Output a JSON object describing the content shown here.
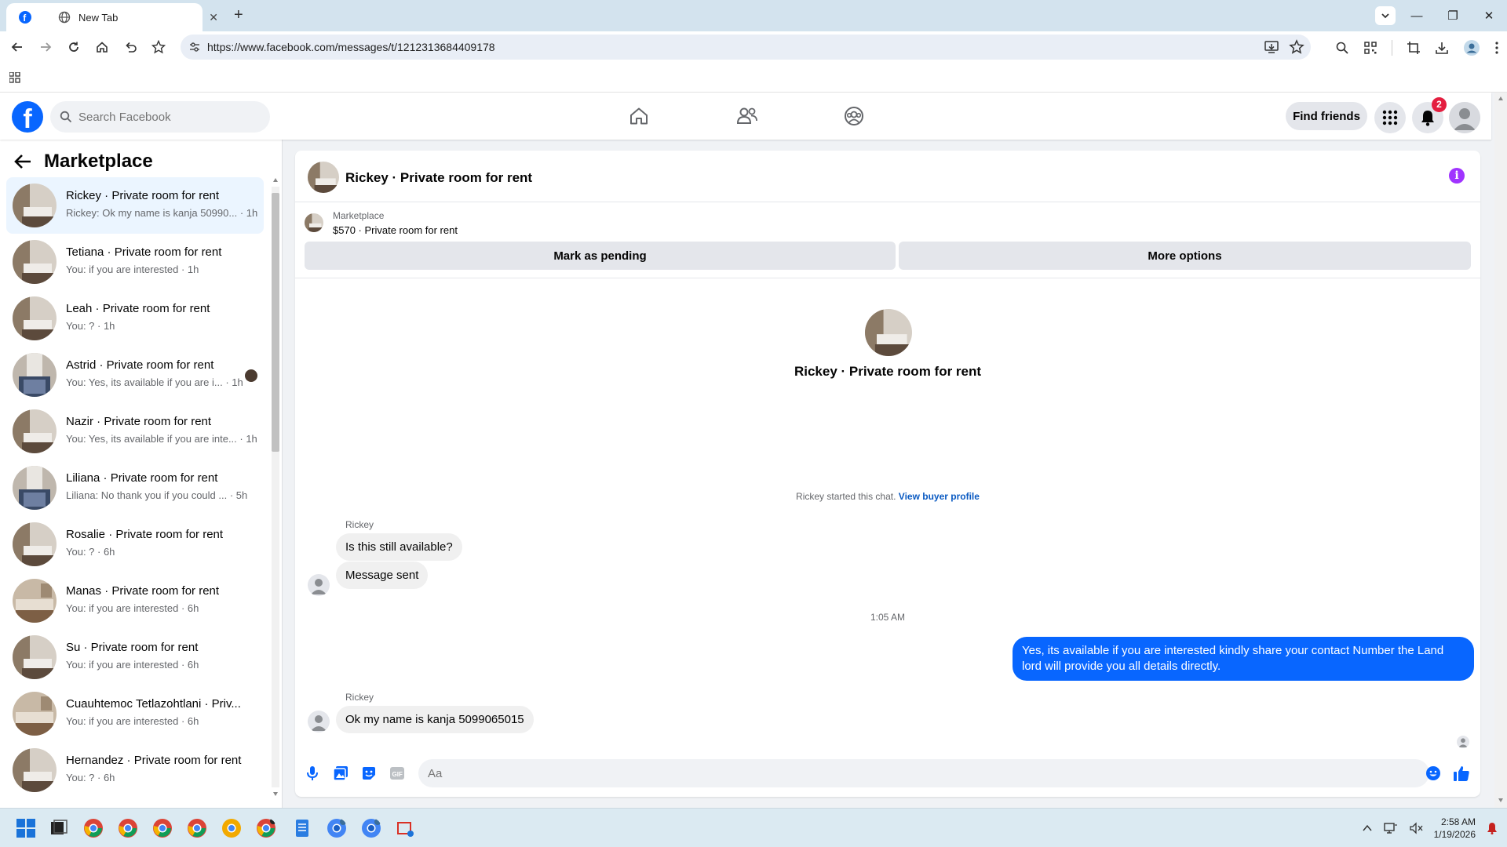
{
  "browser": {
    "tabs": [
      {
        "label": "",
        "active": true
      },
      {
        "label": "New Tab",
        "active": false
      }
    ],
    "url": "https://www.facebook.com/messages/t/1212313684409178"
  },
  "fb_header": {
    "search_placeholder": "Search Facebook",
    "find_friends_label": "Find friends",
    "notification_count": "2"
  },
  "sidebar": {
    "title": "Marketplace",
    "conversations": [
      {
        "name": "Rickey · Private room for rent",
        "preview": "Rickey: Ok my name is kanja 50990... · 1h",
        "selected": true
      },
      {
        "name": "Tetiana · Private room for rent",
        "preview": "You: if you are interested · 1h"
      },
      {
        "name": "Leah · Private room for rent",
        "preview": "You: ? · 1h"
      },
      {
        "name": "Astrid · Private room for rent",
        "preview": "You: Yes, its available if you are i... · 1h"
      },
      {
        "name": "Nazir · Private room for rent",
        "preview": "You: Yes, its available if you are inte... · 1h"
      },
      {
        "name": "Liliana · Private room for rent",
        "preview": "Liliana: No thank you if you could ... · 5h"
      },
      {
        "name": "Rosalie · Private room for rent",
        "preview": "You: ? · 6h"
      },
      {
        "name": "Manas · Private room for rent",
        "preview": "You: if you are interested · 6h"
      },
      {
        "name": "Su · Private room for rent",
        "preview": "You: if you are interested · 6h"
      },
      {
        "name": "Cuauhtemoc Tetlazohtlani · Priv...",
        "preview": "You: if you are interested · 6h"
      },
      {
        "name": "Hernandez · Private room for rent",
        "preview": "You: ? · 6h"
      }
    ]
  },
  "chat": {
    "title": "Rickey · Private room for rent",
    "listing_source": "Marketplace",
    "listing_price": "$570 · Private room for rent",
    "mark_pending_label": "Mark as pending",
    "more_options_label": "More options",
    "center_title": "Rickey · Private room for rent",
    "started_text": "Rickey started this chat.",
    "view_buyer_profile": "View buyer profile",
    "sender_1": "Rickey",
    "msg_1": "Is this still available?",
    "msg_2": "Message sent",
    "timestamp": "1:05 AM",
    "msg_out": "Yes, its available if you are interested kindly share your contact Number the Land lord will provide you all details directly.",
    "sender_2": "Rickey",
    "msg_3": "Ok my name is kanja 5099065015",
    "input_placeholder": "Aa"
  },
  "taskbar": {
    "time": "2:58 AM",
    "date": "1/19/2026"
  },
  "colors": {
    "fb_blue": "#0866ff",
    "info_purple": "#a033ff",
    "badge_red": "#e41e3f"
  }
}
